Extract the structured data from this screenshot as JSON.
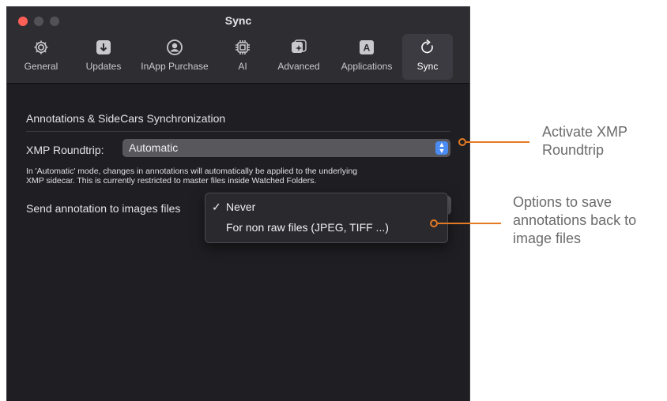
{
  "window": {
    "title": "Sync"
  },
  "toolbar": {
    "tabs": [
      {
        "label": "General",
        "icon": "gear-icon"
      },
      {
        "label": "Updates",
        "icon": "download-icon"
      },
      {
        "label": "InApp Purchase",
        "icon": "person-circle-icon"
      },
      {
        "label": "AI",
        "icon": "cpu-chip-icon"
      },
      {
        "label": "Advanced",
        "icon": "sparkle-square-icon"
      },
      {
        "label": "Applications",
        "icon": "app-letter-icon"
      },
      {
        "label": "Sync",
        "icon": "sync-arrow-icon",
        "active": true
      }
    ]
  },
  "sync": {
    "section_title": "Annotations & SideCars Synchronization",
    "xmp_label": "XMP Roundtrip:",
    "xmp_value": "Automatic",
    "description_line1": "In 'Automatic' mode, changes in annotations will automatically be applied to the underlying",
    "description_line2": "XMP sidecar. This is currently restricted to master files inside Watched Folders.",
    "send_label": "Send annotation to images files",
    "menu": {
      "items": [
        {
          "label": "Never",
          "checked": true
        },
        {
          "label": "For non raw files (JPEG, TIFF ...)",
          "checked": false
        }
      ],
      "check_glyph": "✓"
    }
  },
  "annotations": {
    "xmp": {
      "line1": "Activate XMP",
      "line2": "Roundtrip"
    },
    "options": {
      "line1": "Options to save",
      "line2": "annotations back to",
      "line3": "image files"
    },
    "color": "#e57a23"
  },
  "colors": {
    "accent": "#4a8cf4",
    "close": "#fe5f57",
    "window_bg": "#1f1e22"
  }
}
